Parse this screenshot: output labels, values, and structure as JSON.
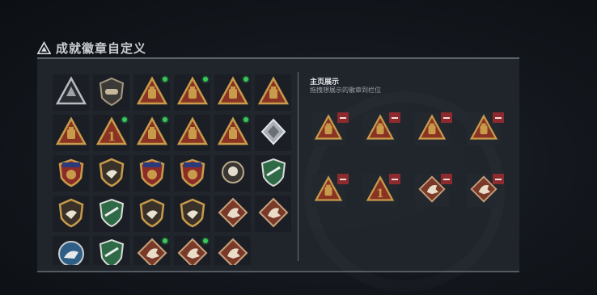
{
  "title": {
    "text": "成就徽章自定义",
    "icon": "warning-triangle-icon"
  },
  "showcase": {
    "title": "主页展示",
    "subtitle": "拖拽想展示的徽章到栏位",
    "remove_icon": "minus-icon",
    "badges": [
      {
        "icon": "tri-bottle-badge",
        "accent": "#c79a4a"
      },
      {
        "icon": "tri-skull-badge",
        "accent": "#c79a4a"
      },
      {
        "icon": "tri-helmet-badge",
        "accent": "#c79a4a"
      },
      {
        "icon": "tri-barrel-badge",
        "accent": "#c79a4a"
      },
      {
        "icon": "tri-tank-badge",
        "accent": "#c79a4a"
      },
      {
        "icon": "tri-number-one-badge",
        "label": "1",
        "accent": "#c79a4a"
      },
      {
        "icon": "diamond-beast-badge",
        "accent": "#b07a5e"
      },
      {
        "icon": "diamond-beast-badge",
        "accent": "#b07a5e"
      }
    ]
  },
  "badges": [
    {
      "icon": "tri-silver-badge",
      "new": false
    },
    {
      "icon": "helicopter-shield-badge",
      "new": false
    },
    {
      "icon": "tri-boot-badge",
      "new": true
    },
    {
      "icon": "tri-skull-badge",
      "new": true
    },
    {
      "icon": "tri-barrel-badge",
      "new": true
    },
    {
      "icon": "tri-card-badge",
      "new": false
    },
    {
      "icon": "tri-tank-badge",
      "new": false
    },
    {
      "icon": "tri-number-one-badge",
      "label": "1",
      "new": true
    },
    {
      "icon": "tri-bottle-badge",
      "new": true
    },
    {
      "icon": "tri-helmet-badge",
      "new": false
    },
    {
      "icon": "tri-soldier-badge",
      "new": true
    },
    {
      "icon": "silver-cube-badge",
      "new": false
    },
    {
      "icon": "star-medal-badge",
      "new": false
    },
    {
      "icon": "shield-fist-badge",
      "new": false
    },
    {
      "icon": "stars-shield-badge",
      "new": false
    },
    {
      "icon": "stars-shield-red-badge",
      "new": false
    },
    {
      "icon": "skull-emblem-badge",
      "new": false
    },
    {
      "icon": "green-shield-badge",
      "new": false
    },
    {
      "icon": "shield-eagle-badge",
      "new": false
    },
    {
      "icon": "green-wolf-shield-badge",
      "new": false
    },
    {
      "icon": "shield-eagle-gold-badge",
      "new": false
    },
    {
      "icon": "wings-skull-badge",
      "new": false
    },
    {
      "icon": "diamond-beast-badge",
      "new": false
    },
    {
      "icon": "diamond-beast-badge",
      "new": false
    },
    {
      "icon": "blue-wolf-badge",
      "new": false
    },
    {
      "icon": "green-rifle-badge",
      "new": false
    },
    {
      "icon": "diamond-beast-badge",
      "new": true
    },
    {
      "icon": "diamond-beast-badge",
      "new": true
    },
    {
      "icon": "diamond-runner-badge",
      "new": false
    }
  ]
}
